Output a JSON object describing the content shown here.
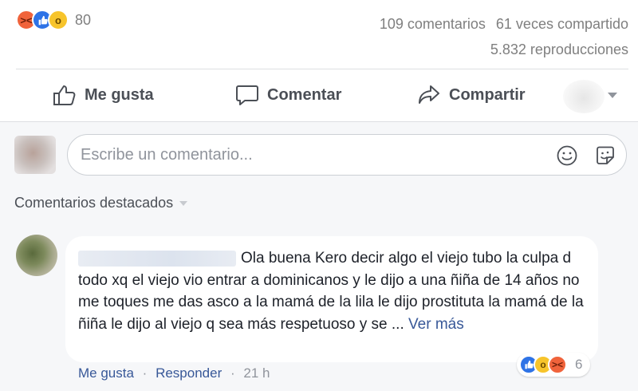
{
  "reactions": {
    "icons": [
      "angry-reaction",
      "like-reaction",
      "wow-reaction"
    ],
    "count": "80"
  },
  "stats": {
    "comments": "109 comentarios",
    "shares": "61 veces compartido",
    "views": "5.832 reproducciones"
  },
  "actions": {
    "like": "Me gusta",
    "comment": "Comentar",
    "share": "Compartir"
  },
  "composer": {
    "placeholder": "Escribe un comentario..."
  },
  "featured": {
    "label": "Comentarios destacados"
  },
  "comment": {
    "text": "Ola buena Kero decir algo el viejo tubo la culpa d todo xq el viejo vio entrar a dominicanos y le dijo a una ñiña de 14 años no me toques me das asco a la mamá de la lila le dijo prostituta la mamá de la ñiña le dijo al viejo q sea más respetuoso y se ...",
    "see_more": "Ver más",
    "reaction_count": "6",
    "reaction_icons": [
      "like-reaction",
      "wow-reaction",
      "angry-reaction"
    ],
    "like_link": "Me gusta",
    "reply_link": "Responder",
    "separator": "·",
    "time": "21 h"
  },
  "colors": {
    "link": "#385898",
    "muted": "#90949c",
    "like_blue": "#2e73e6",
    "angry": "#f0633b",
    "wow": "#f7c42b"
  }
}
